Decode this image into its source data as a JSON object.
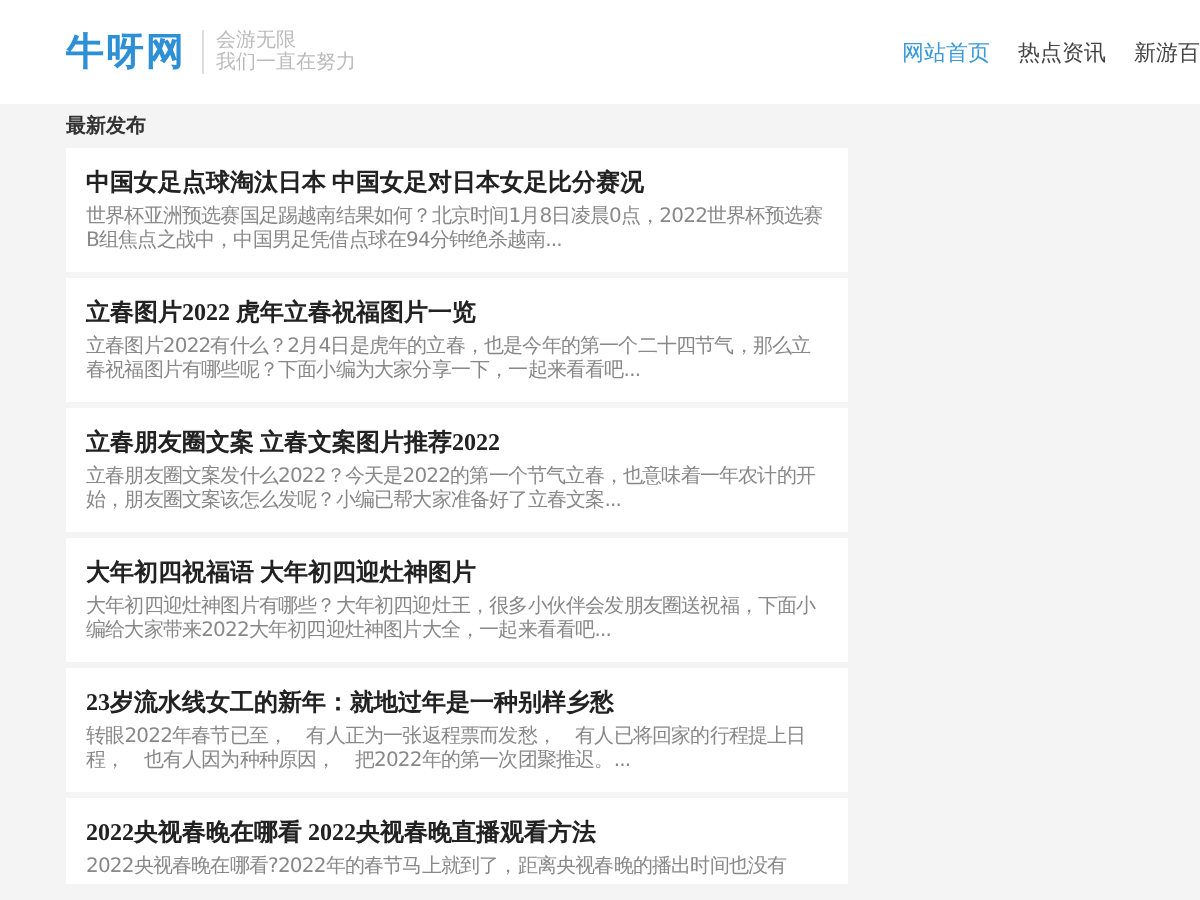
{
  "header": {
    "logo": "牛呀网",
    "slogan": [
      "会游无限",
      "我们一直在努力"
    ],
    "nav": [
      {
        "label": "网站首页",
        "selected": true
      },
      {
        "label": "热点资讯",
        "selected": false
      },
      {
        "label": "新游百",
        "selected": false
      }
    ]
  },
  "section_title": "最新发布",
  "articles": [
    {
      "title": "中国女足点球淘汰日本 中国女足对日本女足比分赛况",
      "summary": "世界杯亚洲预选赛国足踢越南结果如何？北京时间1月8日凌晨0点，2022世界杯预选赛B组焦点之战中，中国男足凭借点球在94分钟绝杀越南..."
    },
    {
      "title": "立春图片2022 虎年立春祝福图片一览",
      "summary": "立春图片2022有什么？2月4日是虎年的立春，也是今年的第一个二十四节气，那么立春祝福图片有哪些呢？下面小编为大家分享一下，一起来看看吧..."
    },
    {
      "title": "立春朋友圈文案 立春文案图片推荐2022",
      "summary": "立春朋友圈文案发什么2022？今天是2022的第一个节气立春，也意味着一年农计的开始，朋友圈文案该怎么发呢？小编已帮大家准备好了立春文案..."
    },
    {
      "title": "大年初四祝福语 大年初四迎灶神图片",
      "summary": "大年初四迎灶神图片有哪些？大年初四迎灶王，很多小伙伴会发朋友圈送祝福，下面小编给大家带来2022大年初四迎灶神图片大全，一起来看看吧..."
    },
    {
      "title": "23岁流水线女工的新年：就地过年是一种别样乡愁",
      "summary": "转眼2022年春节已至，　有人正为一张返程票而发愁，　有人已将回家的行程提上日程，　也有人因为种种原因，　把2022年的第一次团聚推迟。..."
    },
    {
      "title": "2022央视春晚在哪看 2022央视春晚直播观看方法",
      "summary": "2022央视春晚在哪看?2022年的春节马上就到了，距离央视春晚的播出时间也没有"
    }
  ]
}
